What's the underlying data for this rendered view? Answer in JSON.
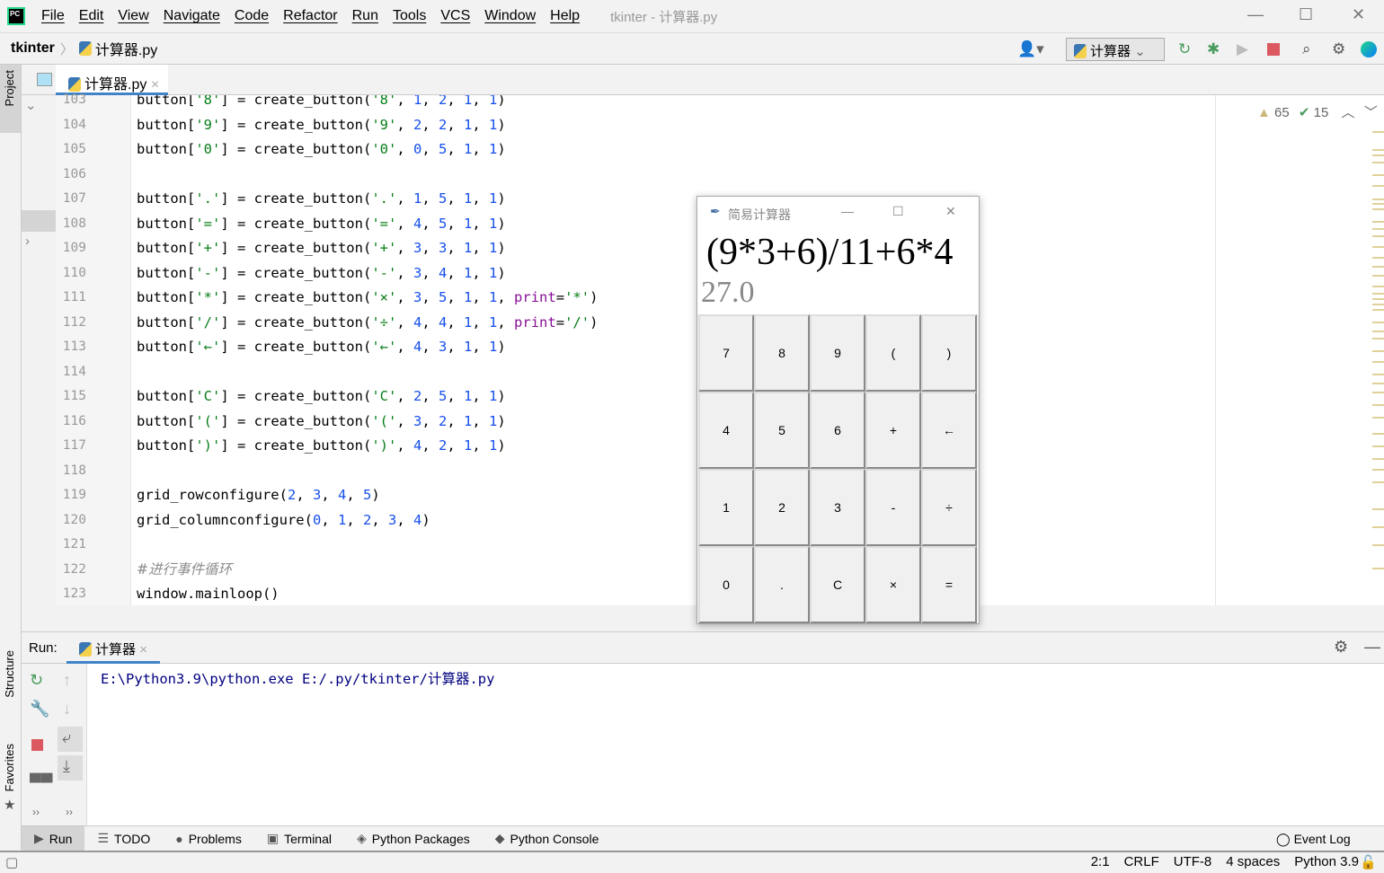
{
  "menubar": {
    "items": [
      "File",
      "Edit",
      "View",
      "Navigate",
      "Code",
      "Refactor",
      "Run",
      "Tools",
      "VCS",
      "Window",
      "Help"
    ],
    "window_title": "tkinter - 计算器.py"
  },
  "navbar": {
    "project": "tkinter",
    "file": "计算器.py",
    "run_config": "计算器"
  },
  "editor": {
    "tab": "计算器.py",
    "warnings": "65",
    "weak_warnings": "15",
    "lines": [
      {
        "n": "103",
        "t": [
          [
            "p",
            "button["
          ],
          [
            "s",
            "'8'"
          ],
          [
            "p",
            "] = create_button("
          ],
          [
            "s",
            "'8'"
          ],
          [
            "p",
            ", "
          ],
          [
            "n",
            "1"
          ],
          [
            "p",
            ", "
          ],
          [
            "n",
            "2"
          ],
          [
            "p",
            ", "
          ],
          [
            "n",
            "1"
          ],
          [
            "p",
            ", "
          ],
          [
            "n",
            "1"
          ],
          [
            "p",
            ")"
          ]
        ]
      },
      {
        "n": "104",
        "t": [
          [
            "p",
            "button["
          ],
          [
            "s",
            "'9'"
          ],
          [
            "p",
            "] = create_button("
          ],
          [
            "s",
            "'9'"
          ],
          [
            "p",
            ", "
          ],
          [
            "n",
            "2"
          ],
          [
            "p",
            ", "
          ],
          [
            "n",
            "2"
          ],
          [
            "p",
            ", "
          ],
          [
            "n",
            "1"
          ],
          [
            "p",
            ", "
          ],
          [
            "n",
            "1"
          ],
          [
            "p",
            ")"
          ]
        ]
      },
      {
        "n": "105",
        "t": [
          [
            "p",
            "button["
          ],
          [
            "s",
            "'0'"
          ],
          [
            "p",
            "] = create_button("
          ],
          [
            "s",
            "'0'"
          ],
          [
            "p",
            ", "
          ],
          [
            "n",
            "0"
          ],
          [
            "p",
            ", "
          ],
          [
            "n",
            "5"
          ],
          [
            "p",
            ", "
          ],
          [
            "n",
            "1"
          ],
          [
            "p",
            ", "
          ],
          [
            "n",
            "1"
          ],
          [
            "p",
            ")"
          ]
        ]
      },
      {
        "n": "106",
        "t": []
      },
      {
        "n": "107",
        "t": [
          [
            "p",
            "button["
          ],
          [
            "s",
            "'.'"
          ],
          [
            "p",
            "] = create_button("
          ],
          [
            "s",
            "'.'"
          ],
          [
            "p",
            ", "
          ],
          [
            "n",
            "1"
          ],
          [
            "p",
            ", "
          ],
          [
            "n",
            "5"
          ],
          [
            "p",
            ", "
          ],
          [
            "n",
            "1"
          ],
          [
            "p",
            ", "
          ],
          [
            "n",
            "1"
          ],
          [
            "p",
            ")"
          ]
        ]
      },
      {
        "n": "108",
        "t": [
          [
            "p",
            "button["
          ],
          [
            "s",
            "'='"
          ],
          [
            "p",
            "] = create_button("
          ],
          [
            "s",
            "'='"
          ],
          [
            "p",
            ", "
          ],
          [
            "n",
            "4"
          ],
          [
            "p",
            ", "
          ],
          [
            "n",
            "5"
          ],
          [
            "p",
            ", "
          ],
          [
            "n",
            "1"
          ],
          [
            "p",
            ", "
          ],
          [
            "n",
            "1"
          ],
          [
            "p",
            ")"
          ]
        ]
      },
      {
        "n": "109",
        "t": [
          [
            "p",
            "button["
          ],
          [
            "s",
            "'+'"
          ],
          [
            "p",
            "] = create_button("
          ],
          [
            "s",
            "'+'"
          ],
          [
            "p",
            ", "
          ],
          [
            "n",
            "3"
          ],
          [
            "p",
            ", "
          ],
          [
            "n",
            "3"
          ],
          [
            "p",
            ", "
          ],
          [
            "n",
            "1"
          ],
          [
            "p",
            ", "
          ],
          [
            "n",
            "1"
          ],
          [
            "p",
            ")"
          ]
        ]
      },
      {
        "n": "110",
        "t": [
          [
            "p",
            "button["
          ],
          [
            "s",
            "'-'"
          ],
          [
            "p",
            "] = create_button("
          ],
          [
            "s",
            "'-'"
          ],
          [
            "p",
            ", "
          ],
          [
            "n",
            "3"
          ],
          [
            "p",
            ", "
          ],
          [
            "n",
            "4"
          ],
          [
            "p",
            ", "
          ],
          [
            "n",
            "1"
          ],
          [
            "p",
            ", "
          ],
          [
            "n",
            "1"
          ],
          [
            "p",
            ")"
          ]
        ]
      },
      {
        "n": "111",
        "t": [
          [
            "p",
            "button["
          ],
          [
            "s",
            "'*'"
          ],
          [
            "p",
            "] = create_button("
          ],
          [
            "s",
            "'×'"
          ],
          [
            "p",
            ", "
          ],
          [
            "n",
            "3"
          ],
          [
            "p",
            ", "
          ],
          [
            "n",
            "5"
          ],
          [
            "p",
            ", "
          ],
          [
            "n",
            "1"
          ],
          [
            "p",
            ", "
          ],
          [
            "n",
            "1"
          ],
          [
            "p",
            ", "
          ],
          [
            "k",
            "print"
          ],
          [
            "p",
            "="
          ],
          [
            "s",
            "'*'"
          ],
          [
            "p",
            ")"
          ]
        ]
      },
      {
        "n": "112",
        "t": [
          [
            "p",
            "button["
          ],
          [
            "s",
            "'/'"
          ],
          [
            "p",
            "] = create_button("
          ],
          [
            "s",
            "'÷'"
          ],
          [
            "p",
            ", "
          ],
          [
            "n",
            "4"
          ],
          [
            "p",
            ", "
          ],
          [
            "n",
            "4"
          ],
          [
            "p",
            ", "
          ],
          [
            "n",
            "1"
          ],
          [
            "p",
            ", "
          ],
          [
            "n",
            "1"
          ],
          [
            "p",
            ", "
          ],
          [
            "k",
            "print"
          ],
          [
            "p",
            "="
          ],
          [
            "s",
            "'/'"
          ],
          [
            "p",
            ")"
          ]
        ]
      },
      {
        "n": "113",
        "t": [
          [
            "p",
            "button["
          ],
          [
            "s",
            "'←'"
          ],
          [
            "p",
            "] = create_button("
          ],
          [
            "s",
            "'←'"
          ],
          [
            "p",
            ", "
          ],
          [
            "n",
            "4"
          ],
          [
            "p",
            ", "
          ],
          [
            "n",
            "3"
          ],
          [
            "p",
            ", "
          ],
          [
            "n",
            "1"
          ],
          [
            "p",
            ", "
          ],
          [
            "n",
            "1"
          ],
          [
            "p",
            ")"
          ]
        ]
      },
      {
        "n": "114",
        "t": []
      },
      {
        "n": "115",
        "t": [
          [
            "p",
            "button["
          ],
          [
            "s",
            "'C'"
          ],
          [
            "p",
            "] = create_button("
          ],
          [
            "s",
            "'C'"
          ],
          [
            "p",
            ", "
          ],
          [
            "n",
            "2"
          ],
          [
            "p",
            ", "
          ],
          [
            "n",
            "5"
          ],
          [
            "p",
            ", "
          ],
          [
            "n",
            "1"
          ],
          [
            "p",
            ", "
          ],
          [
            "n",
            "1"
          ],
          [
            "p",
            ")"
          ]
        ]
      },
      {
        "n": "116",
        "t": [
          [
            "p",
            "button["
          ],
          [
            "s",
            "'('"
          ],
          [
            "p",
            "] = create_button("
          ],
          [
            "s",
            "'('"
          ],
          [
            "p",
            ", "
          ],
          [
            "n",
            "3"
          ],
          [
            "p",
            ", "
          ],
          [
            "n",
            "2"
          ],
          [
            "p",
            ", "
          ],
          [
            "n",
            "1"
          ],
          [
            "p",
            ", "
          ],
          [
            "n",
            "1"
          ],
          [
            "p",
            ")"
          ]
        ]
      },
      {
        "n": "117",
        "t": [
          [
            "p",
            "button["
          ],
          [
            "s",
            "')'"
          ],
          [
            "p",
            "] = create_button("
          ],
          [
            "s",
            "')'"
          ],
          [
            "p",
            ", "
          ],
          [
            "n",
            "4"
          ],
          [
            "p",
            ", "
          ],
          [
            "n",
            "2"
          ],
          [
            "p",
            ", "
          ],
          [
            "n",
            "1"
          ],
          [
            "p",
            ", "
          ],
          [
            "n",
            "1"
          ],
          [
            "p",
            ")"
          ]
        ]
      },
      {
        "n": "118",
        "t": []
      },
      {
        "n": "119",
        "t": [
          [
            "p",
            "grid_rowconfigure("
          ],
          [
            "n",
            "2"
          ],
          [
            "p",
            ", "
          ],
          [
            "n",
            "3"
          ],
          [
            "p",
            ", "
          ],
          [
            "n",
            "4"
          ],
          [
            "p",
            ", "
          ],
          [
            "n",
            "5"
          ],
          [
            "p",
            ")"
          ]
        ]
      },
      {
        "n": "120",
        "t": [
          [
            "p",
            "grid_columnconfigure("
          ],
          [
            "n",
            "0"
          ],
          [
            "p",
            ", "
          ],
          [
            "n",
            "1"
          ],
          [
            "p",
            ", "
          ],
          [
            "n",
            "2"
          ],
          [
            "p",
            ", "
          ],
          [
            "n",
            "3"
          ],
          [
            "p",
            ", "
          ],
          [
            "n",
            "4"
          ],
          [
            "p",
            ")"
          ]
        ]
      },
      {
        "n": "121",
        "t": []
      },
      {
        "n": "122",
        "t": [
          [
            "c",
            "#进行事件循环"
          ]
        ]
      },
      {
        "n": "123",
        "t": [
          [
            "p",
            "window.mainloop()"
          ]
        ]
      }
    ]
  },
  "calculator": {
    "title": "简易计算器",
    "expression": "(9*3+6)/11+6*4",
    "result": "27.0",
    "buttons": [
      "7",
      "8",
      "9",
      "(",
      ")",
      "4",
      "5",
      "6",
      "+",
      "←",
      "1",
      "2",
      "3",
      "-",
      "÷",
      "0",
      ".",
      "C",
      "×",
      "="
    ]
  },
  "run": {
    "label": "Run:",
    "tab": "计算器",
    "output": "E:\\Python3.9\\python.exe E:/.py/tkinter/计算器.py"
  },
  "sidebar": {
    "project": "Project",
    "structure": "Structure",
    "favorites": "Favorites"
  },
  "bottom_tabs": [
    "Run",
    "TODO",
    "Problems",
    "Terminal",
    "Python Packages",
    "Python Console"
  ],
  "event_log": "Event Log",
  "status": {
    "position": "2:1",
    "line_sep": "CRLF",
    "encoding": "UTF-8",
    "indent": "4 spaces",
    "interpreter": "Python 3.9"
  },
  "colors": {
    "string": "#067d17",
    "number": "#1750eb",
    "keyword_arg": "#871094",
    "accent": "#4083c9"
  }
}
